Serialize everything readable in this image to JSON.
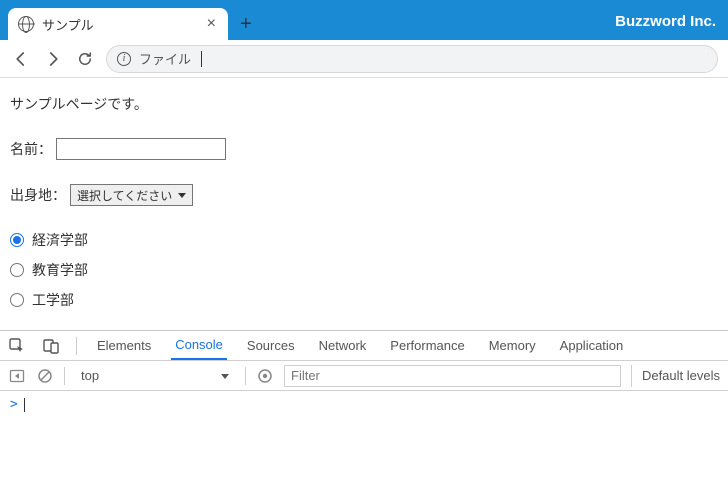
{
  "brand": "Buzzword Inc.",
  "tab": {
    "title": "サンプル",
    "close": "×",
    "new_tab": "+"
  },
  "addr": {
    "scheme": "ファイル"
  },
  "page": {
    "intro": "サンプルページです。",
    "name_label": "名前：",
    "name_value": "",
    "origin_label": "出身地：",
    "origin_selected": "選択してください",
    "radios": [
      {
        "label": "経済学部",
        "checked": true
      },
      {
        "label": "教育学部",
        "checked": false
      },
      {
        "label": "工学部",
        "checked": false
      }
    ]
  },
  "devtools": {
    "tabs": {
      "elements": "Elements",
      "console": "Console",
      "sources": "Sources",
      "network": "Network",
      "performance": "Performance",
      "memory": "Memory",
      "application": "Application"
    },
    "filter": {
      "context": "top",
      "placeholder": "Filter",
      "levels": "Default levels"
    },
    "prompt": ">"
  }
}
